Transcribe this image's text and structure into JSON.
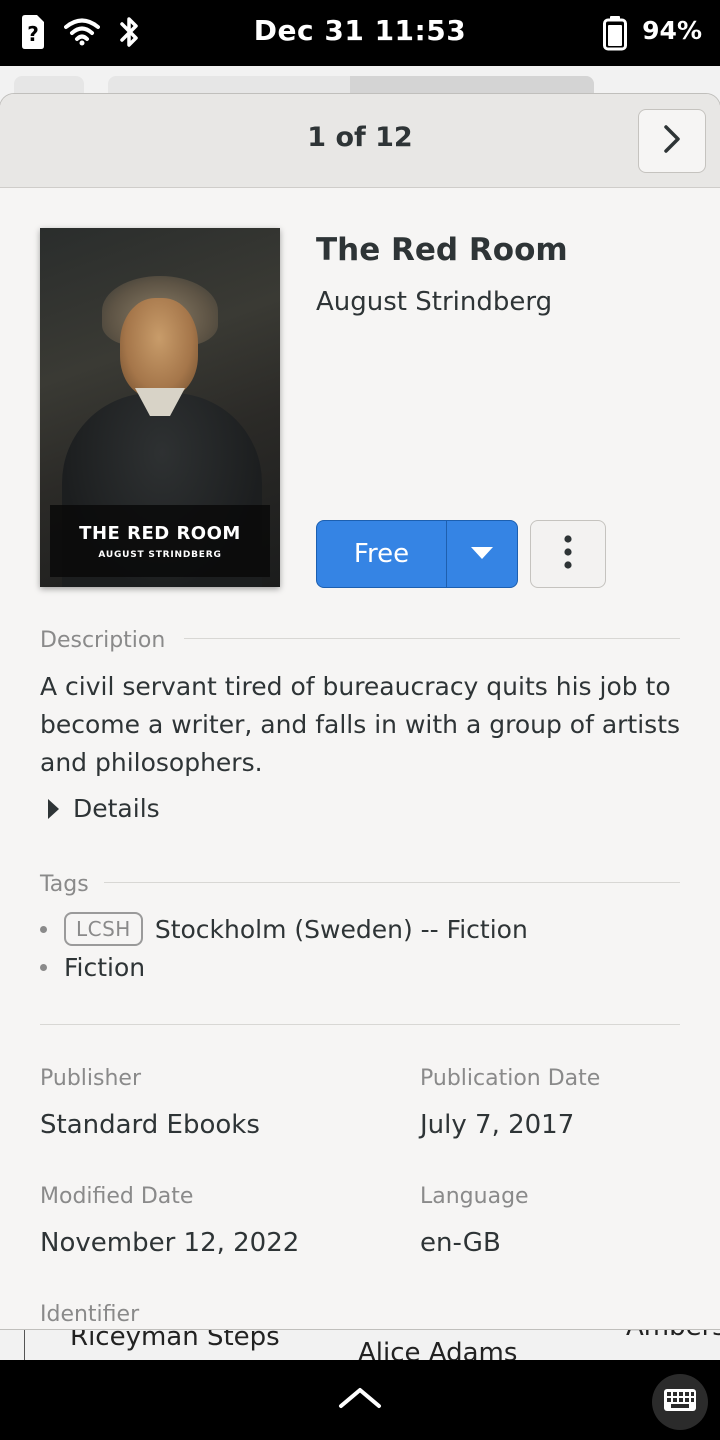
{
  "status_bar": {
    "clock": "Dec 31  11:53",
    "battery_percent": "94%",
    "icons": [
      "unknown-sim-icon",
      "wifi-icon",
      "bluetooth-icon",
      "battery-icon"
    ]
  },
  "background_app": {
    "visible_books": [
      "Riceyman Steps",
      "Alice Adams",
      "Ambers"
    ]
  },
  "dialog": {
    "pager": "1 of 12",
    "book": {
      "title": "The Red Room",
      "author": "August Strindberg",
      "cover": {
        "title": "THE RED ROOM",
        "author": "AUGUST STRINDBERG"
      }
    },
    "actions": {
      "primary_label": "Free"
    },
    "description": {
      "heading": "Description",
      "text": "A civil servant tired of bureaucracy quits his job to become a writer, and falls in with a group of artists and philosophers.",
      "details_label": "Details"
    },
    "tags": {
      "heading": "Tags",
      "items": [
        {
          "scheme": "LCSH",
          "label": "Stockholm (Sweden) -- Fiction"
        },
        {
          "scheme": "",
          "label": "Fiction"
        }
      ]
    },
    "metadata": {
      "publisher_label": "Publisher",
      "publisher": "Standard Ebooks",
      "publication_date_label": "Publication Date",
      "publication_date": "July 7, 2017",
      "modified_date_label": "Modified Date",
      "modified_date": "November 12, 2022",
      "language_label": "Language",
      "language": "en-GB",
      "identifier_label": "Identifier"
    }
  },
  "colors": {
    "accent": "#3584e4",
    "dialog_bg": "#f6f5f4",
    "header_bg": "#e8e7e5",
    "dim_text": "#8a8a8a"
  }
}
